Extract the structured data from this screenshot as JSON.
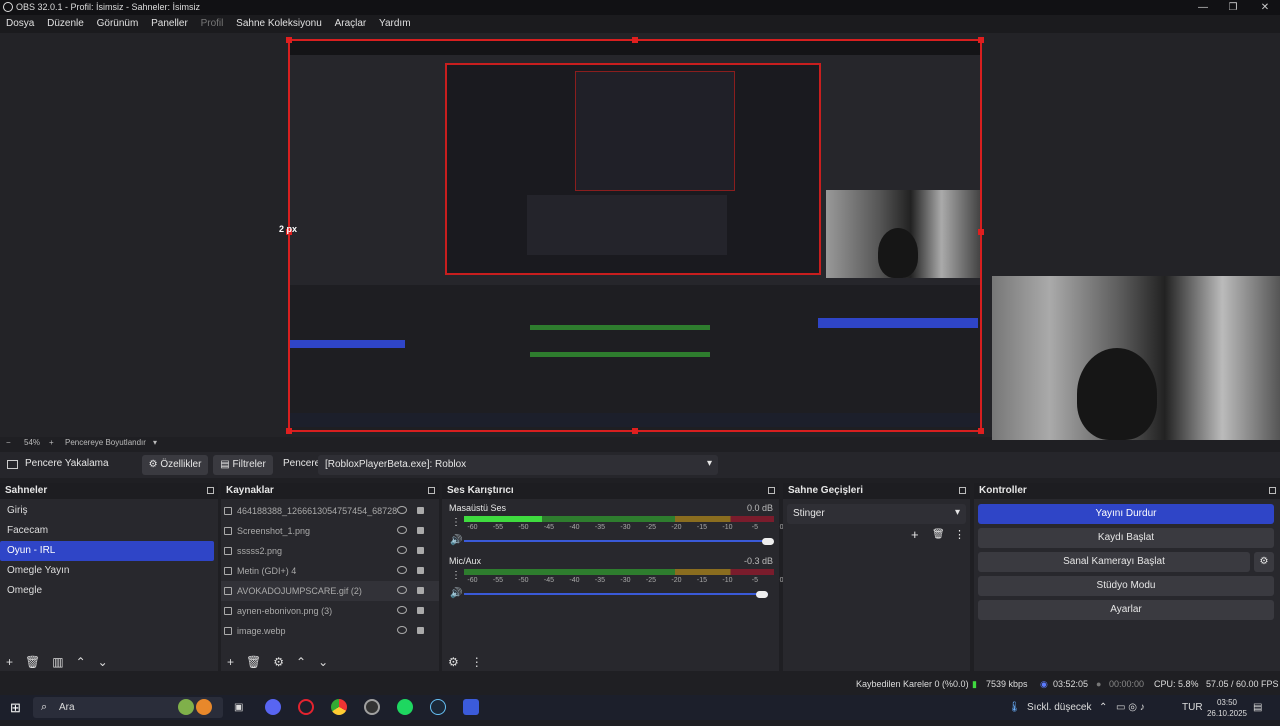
{
  "window": {
    "title": "OBS 32.0.1 - Profil: İsimsiz - Sahneler: İsimsiz"
  },
  "menu": [
    "Dosya",
    "Düzenle",
    "Görünüm",
    "Paneller",
    "Profil",
    "Sahne Koleksiyonu",
    "Araçlar",
    "Yardım"
  ],
  "preview": {
    "size_label": "2 px",
    "zoom": "54%",
    "fit_label": "Pencereye Boyutlandır",
    "zoom_minus": "−",
    "zoom_plus": "+"
  },
  "source_toolbar": {
    "source_name": "Pencere Yakalama",
    "properties": "Özellikler",
    "filters": "Filtreler",
    "window_label": "Pencere",
    "window_value": "[RobloxPlayerBeta.exe]: Roblox"
  },
  "scenes": {
    "title": "Sahneler",
    "items": [
      "Giriş",
      "Facecam",
      "Oyun - IRL",
      "Omegle Yayın",
      "Omegle"
    ],
    "selected_index": 2
  },
  "sources": {
    "title": "Kaynaklar",
    "items": [
      "464188388_1266613054757454_68728",
      "Screenshot_1.png",
      "sssss2.png",
      "Metin (GDI+) 4",
      "AVOKADOJUMPSCARE.gif (2)",
      "aynen-ebonivon.png (3)",
      "image.webp"
    ]
  },
  "mixer": {
    "title": "Ses Karıştırıcı",
    "channels": [
      {
        "name": "Masaüstü Ses",
        "db": "0.0 dB",
        "level": 0.25,
        "volume": 1.0
      },
      {
        "name": "Mic/Aux",
        "db": "-0.3 dB",
        "level": 0.0,
        "volume": 0.99
      }
    ],
    "ticks": [
      "-60",
      "-55",
      "-50",
      "-45",
      "-40",
      "-35",
      "-30",
      "-25",
      "-20",
      "-15",
      "-10",
      "-5",
      "0"
    ]
  },
  "transitions": {
    "title": "Sahne Geçişleri",
    "selected": "Stinger"
  },
  "controls": {
    "title": "Kontroller",
    "stop_stream": "Yayını Durdur",
    "start_record": "Kaydı Başlat",
    "start_virtualcam": "Sanal Kamerayı Başlat",
    "studio_mode": "Stüdyo Modu",
    "settings": "Ayarlar"
  },
  "status": {
    "dropped": "Kaybedilen Kareler 0 (%0.0)",
    "bitrate": "7539 kbps",
    "stream_time": "03:52:05",
    "record_time": "00:00:00",
    "cpu": "CPU: 5.8%",
    "fps": "57.05 / 60.00 FPS"
  },
  "taskbar": {
    "search": "Ara",
    "weather": "Sıckl. düşecek",
    "lang": "TUR",
    "time": "03:50",
    "date": "26.10.2025"
  },
  "colors": {
    "accent": "#2f45c7",
    "selection_border": "#d81f1f"
  }
}
